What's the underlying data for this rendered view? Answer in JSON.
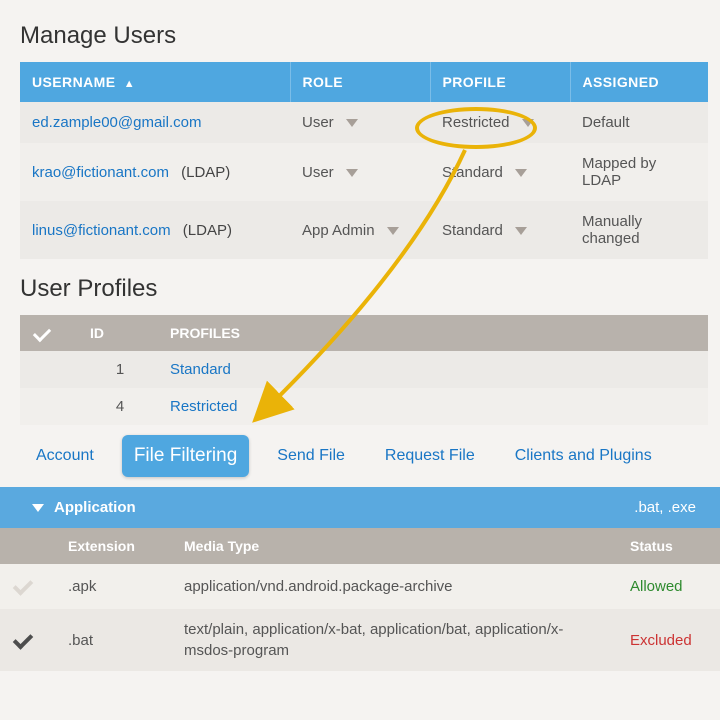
{
  "manage_users": {
    "title": "Manage Users",
    "headers": {
      "username": "USERNAME",
      "role": "ROLE",
      "profile": "PROFILE",
      "assigned": "ASSIGNED"
    },
    "rows": [
      {
        "username": "ed.zample00@gmail.com",
        "ldap": "",
        "role": "User",
        "profile": "Restricted",
        "assigned": "Default"
      },
      {
        "username": "krao@fictionant.com",
        "ldap": "(LDAP)",
        "role": "User",
        "profile": "Standard",
        "assigned": "Mapped by LDAP"
      },
      {
        "username": "linus@fictionant.com",
        "ldap": "(LDAP)",
        "role": "App Admin",
        "profile": "Standard",
        "assigned": "Manually changed"
      }
    ]
  },
  "user_profiles": {
    "title": "User Profiles",
    "headers": {
      "id": "ID",
      "profiles": "PROFILES"
    },
    "rows": [
      {
        "id": "1",
        "name": "Standard"
      },
      {
        "id": "4",
        "name": "Restricted"
      }
    ]
  },
  "tabs": {
    "account": "Account",
    "file_filtering": "File Filtering",
    "send_file": "Send File",
    "request_file": "Request File",
    "clients_plugins": "Clients and Plugins",
    "active": "file_filtering"
  },
  "application_group": {
    "label": "Application",
    "summary": ".bat, .exe"
  },
  "file_filtering": {
    "headers": {
      "extension": "Extension",
      "media_type": "Media Type",
      "status": "Status"
    },
    "rows": [
      {
        "selected": false,
        "ext": ".apk",
        "media": "application/vnd.android.package-archive",
        "status": "Allowed",
        "status_class": "allowed"
      },
      {
        "selected": true,
        "ext": ".bat",
        "media": "text/plain, application/x-bat, application/bat, application/x-msdos-program",
        "status": "Excluded",
        "status_class": "excluded"
      }
    ]
  }
}
